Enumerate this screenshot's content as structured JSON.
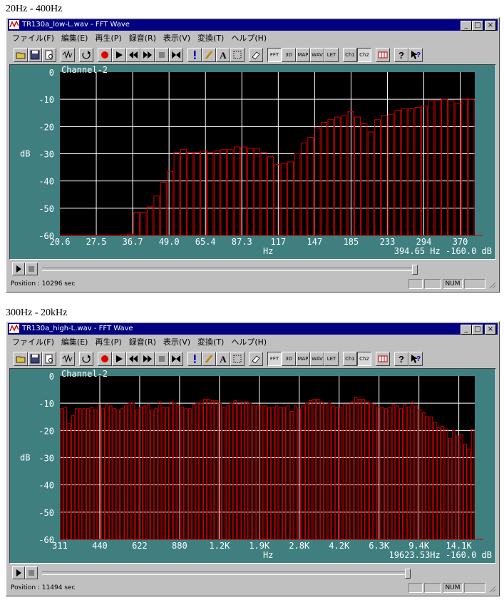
{
  "sections": [
    {
      "heading": "20Hz - 400Hz",
      "window_title": "TR130a_low-L.wav - FFT Wave",
      "channel_label": "Channel-2",
      "y_unit": "dB",
      "x_unit": "Hz",
      "x_ticks": [
        "20.6",
        "27.5",
        "36.7",
        "49.0",
        "65.4",
        "87.3",
        "117",
        "147",
        "185",
        "233",
        "294",
        "370"
      ],
      "y_ticks": [
        "0",
        "-10",
        "-20",
        "-30",
        "-40",
        "-50",
        "-60"
      ],
      "readout": "394.65  Hz -160.0 dB",
      "status_position": "Position : 10296 sec",
      "status_num": "NUM"
    },
    {
      "heading": "300Hz - 20kHz",
      "window_title": "TR130a_high-L.wav - FFT Wave",
      "channel_label": "Channel-2",
      "y_unit": "dB",
      "x_unit": "Hz",
      "x_ticks": [
        "311",
        "440",
        "622",
        "880",
        "1.2K",
        "1.9K",
        "2.8K",
        "4.2K",
        "6.3K",
        "9.4K",
        "14.1K"
      ],
      "y_ticks": [
        "0",
        "-10",
        "-20",
        "-30",
        "-40",
        "-50",
        "-60"
      ],
      "readout": "19623.53Hz -160.0 dB",
      "status_position": "Position : 11494 sec",
      "status_num": "NUM"
    }
  ],
  "menu": [
    "ファイル(F)",
    "編集(E)",
    "再生(P)",
    "録音(R)",
    "表示(V)",
    "変換(T)",
    "ヘルプ(H)"
  ],
  "toolbar_text": {
    "fft": "FFT",
    "d3": "3D",
    "map": "MAP",
    "wav": "WAV",
    "let": "LET",
    "ch1": "Ch1",
    "ch2": "Ch2"
  },
  "window_buttons": {
    "minimize": "_",
    "maximize": "□",
    "close": "×"
  },
  "colors": {
    "title_bar": "#000080",
    "chart_panel": "#3f7f7f",
    "plot_bg": "#000000",
    "grid": "#ffffff",
    "bars": "#cc0000",
    "chrome": "#c0c0c0"
  },
  "chart_data": [
    {
      "type": "bar",
      "title": "Channel-2",
      "xlabel": "Hz",
      "ylabel": "dB",
      "ylim": [
        -60,
        0
      ],
      "x_scale": "log",
      "grid": true,
      "categories": [
        "20.6",
        "27.5",
        "36.7",
        "49.0",
        "65.4",
        "87.3",
        "117",
        "147",
        "185",
        "233",
        "294",
        "370"
      ],
      "values": [
        -60,
        -60,
        -60,
        -60,
        -60,
        -60,
        -60,
        -60,
        -60,
        -60,
        -59.5,
        -51.5,
        -51.5,
        -49.5,
        -45.5,
        -40.5,
        -36.5,
        -29.5,
        -28.5,
        -29.5,
        -29.5,
        -29,
        -29.5,
        -29,
        -28.5,
        -28.5,
        -27.5,
        -27.5,
        -28,
        -28,
        -29.5,
        -31,
        -34,
        -33.5,
        -33,
        -30,
        -26,
        -24,
        -20.5,
        -18.5,
        -17.5,
        -16.5,
        -16,
        -14.5,
        -16.5,
        -19,
        -22,
        -17.5,
        -16,
        -15.5,
        -14,
        -13.5,
        -13.5,
        -13,
        -12.5,
        -10.5,
        -10.5,
        -10,
        -10.5,
        -11.5,
        -10,
        -10
      ]
    },
    {
      "type": "bar",
      "title": "Channel-2",
      "xlabel": "Hz",
      "ylabel": "dB",
      "ylim": [
        -60,
        0
      ],
      "x_scale": "log",
      "grid": true,
      "categories": [
        "311",
        "440",
        "622",
        "880",
        "1.2K",
        "1.9K",
        "2.8K",
        "4.2K",
        "6.3K",
        "9.4K",
        "14.1K"
      ],
      "values": [
        -12,
        -11.5,
        -17.5,
        -14.5,
        -12,
        -12,
        -12,
        -12,
        -11.5,
        -12.5,
        -10.5,
        -12,
        -10.5,
        -11,
        -12,
        -12.5,
        -12,
        -11,
        -10,
        -10,
        -12.5,
        -11.5,
        -11,
        -10.5,
        -12.5,
        -12,
        -9.5,
        -11.5,
        -11.5,
        -9.5,
        -10,
        -11,
        -11.5,
        -12,
        -12,
        -10.5,
        -10,
        -10,
        -8.5,
        -8.5,
        -9,
        -9,
        -10,
        -11.5,
        -11,
        -10,
        -9,
        -10.5,
        -9.5,
        -9.5,
        -10,
        -11,
        -11,
        -11,
        -11,
        -11.5,
        -11.5,
        -11,
        -11.5,
        -11.5,
        -11,
        -13,
        -11,
        -12,
        -11,
        -10,
        -9,
        -8.5,
        -8.5,
        -9.5,
        -10.5,
        -10,
        -11,
        -11.5,
        -11.5,
        -10.5,
        -10.5,
        -9.5,
        -8,
        -8.5,
        -8.5,
        -9.5,
        -10,
        -10.5,
        -11.5,
        -11.5,
        -12,
        -11.5,
        -10.5,
        -11,
        -12,
        -10.5,
        -11.5,
        -9.5,
        -11,
        -12.5,
        -13.5,
        -15,
        -15,
        -17,
        -19,
        -18.5,
        -19.5,
        -23,
        -20,
        -22,
        -21.5,
        -25,
        -27,
        -19.5
      ]
    }
  ]
}
